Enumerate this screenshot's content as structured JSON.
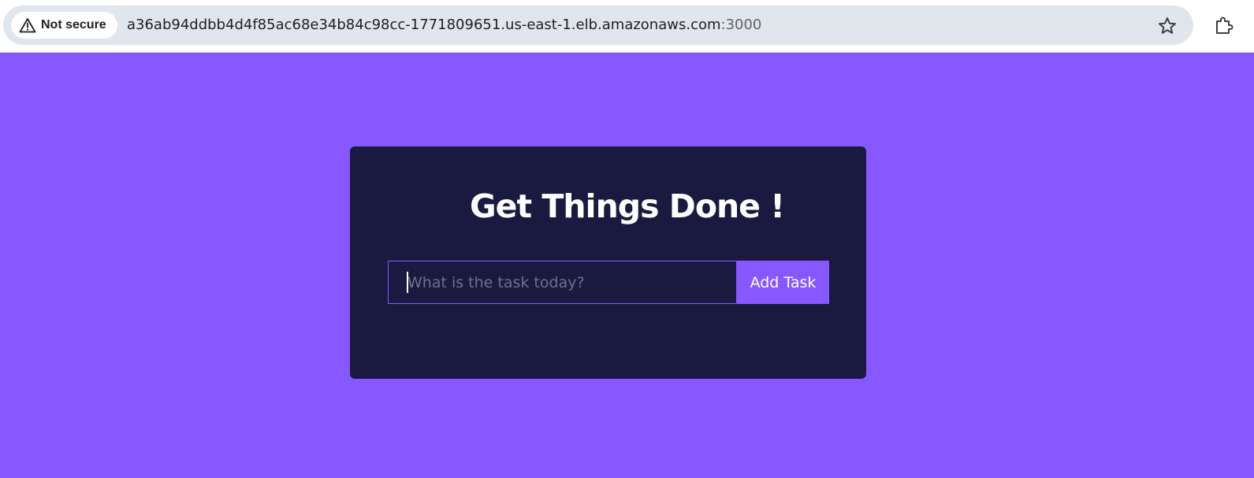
{
  "browser": {
    "security_label": "Not secure",
    "url_host": "a36ab94ddbb4d4f85ac68e34b84c98cc-1771809651.us-east-1.elb.amazonaws.com",
    "url_port": ":3000",
    "icons": {
      "security": "warning-triangle-icon",
      "bookmark": "star-icon",
      "extensions": "puzzle-icon"
    }
  },
  "app": {
    "title": "Get Things Done !",
    "input": {
      "placeholder": "What is the task today?",
      "value": ""
    },
    "add_button_label": "Add Task"
  },
  "colors": {
    "page_background": "#8758FF",
    "card_background": "#1A1A40",
    "accent": "#8758FF",
    "text": "#FFFFFF"
  }
}
